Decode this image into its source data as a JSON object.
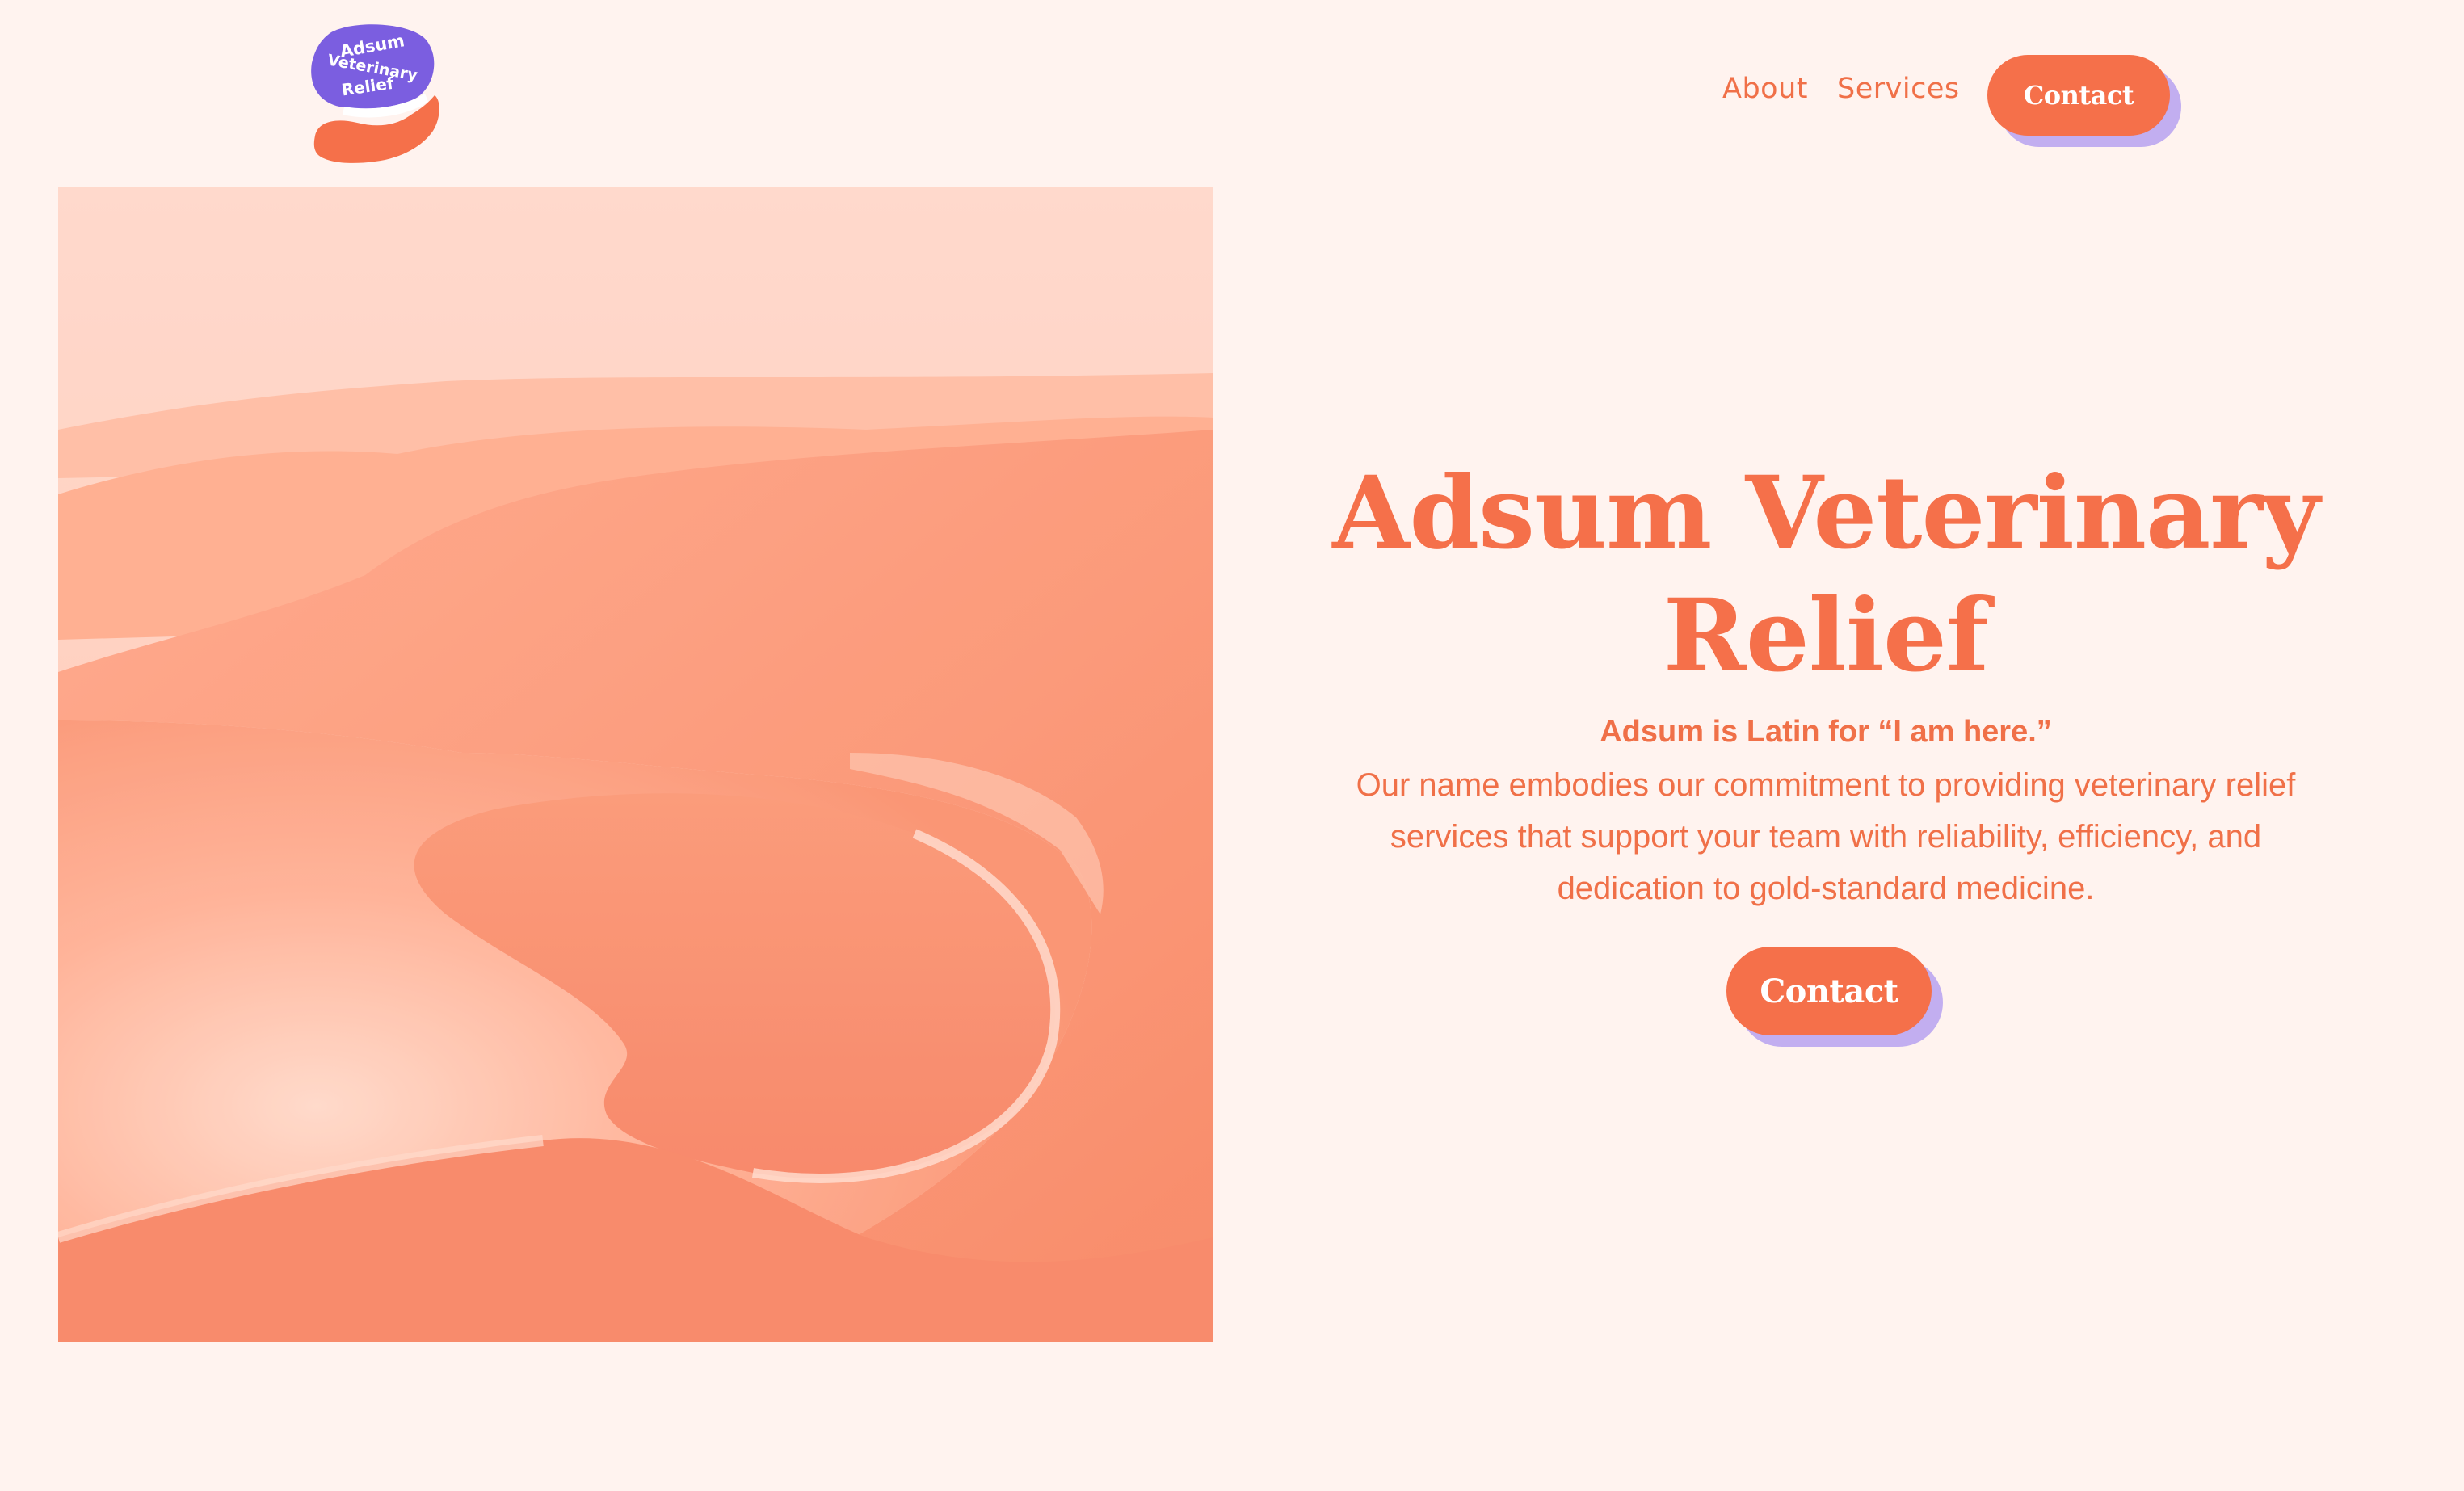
{
  "brand": {
    "logo_lines": [
      "Adsum",
      "Veterinary",
      "Relief"
    ],
    "logo_icon": "hand-holding-speech-bubble-icon"
  },
  "nav": {
    "about": "About",
    "services": "Services",
    "contact": "Contact"
  },
  "hero": {
    "image": "coastal-cliffs-aerial-photo",
    "title": "Adsum Veterinary Relief",
    "tagline": "Adsum is Latin for “I am here.”",
    "description": "Our name embodies our commitment to providing veterinary relief services that support your team with reliability, efficiency, and dedication to gold-standard medicine.",
    "cta": "Contact"
  },
  "colors": {
    "background": "#fff3ef",
    "accent": "#f5704a",
    "button_shadow": "#c2aef0",
    "logo_purple": "#7b5ee0"
  }
}
